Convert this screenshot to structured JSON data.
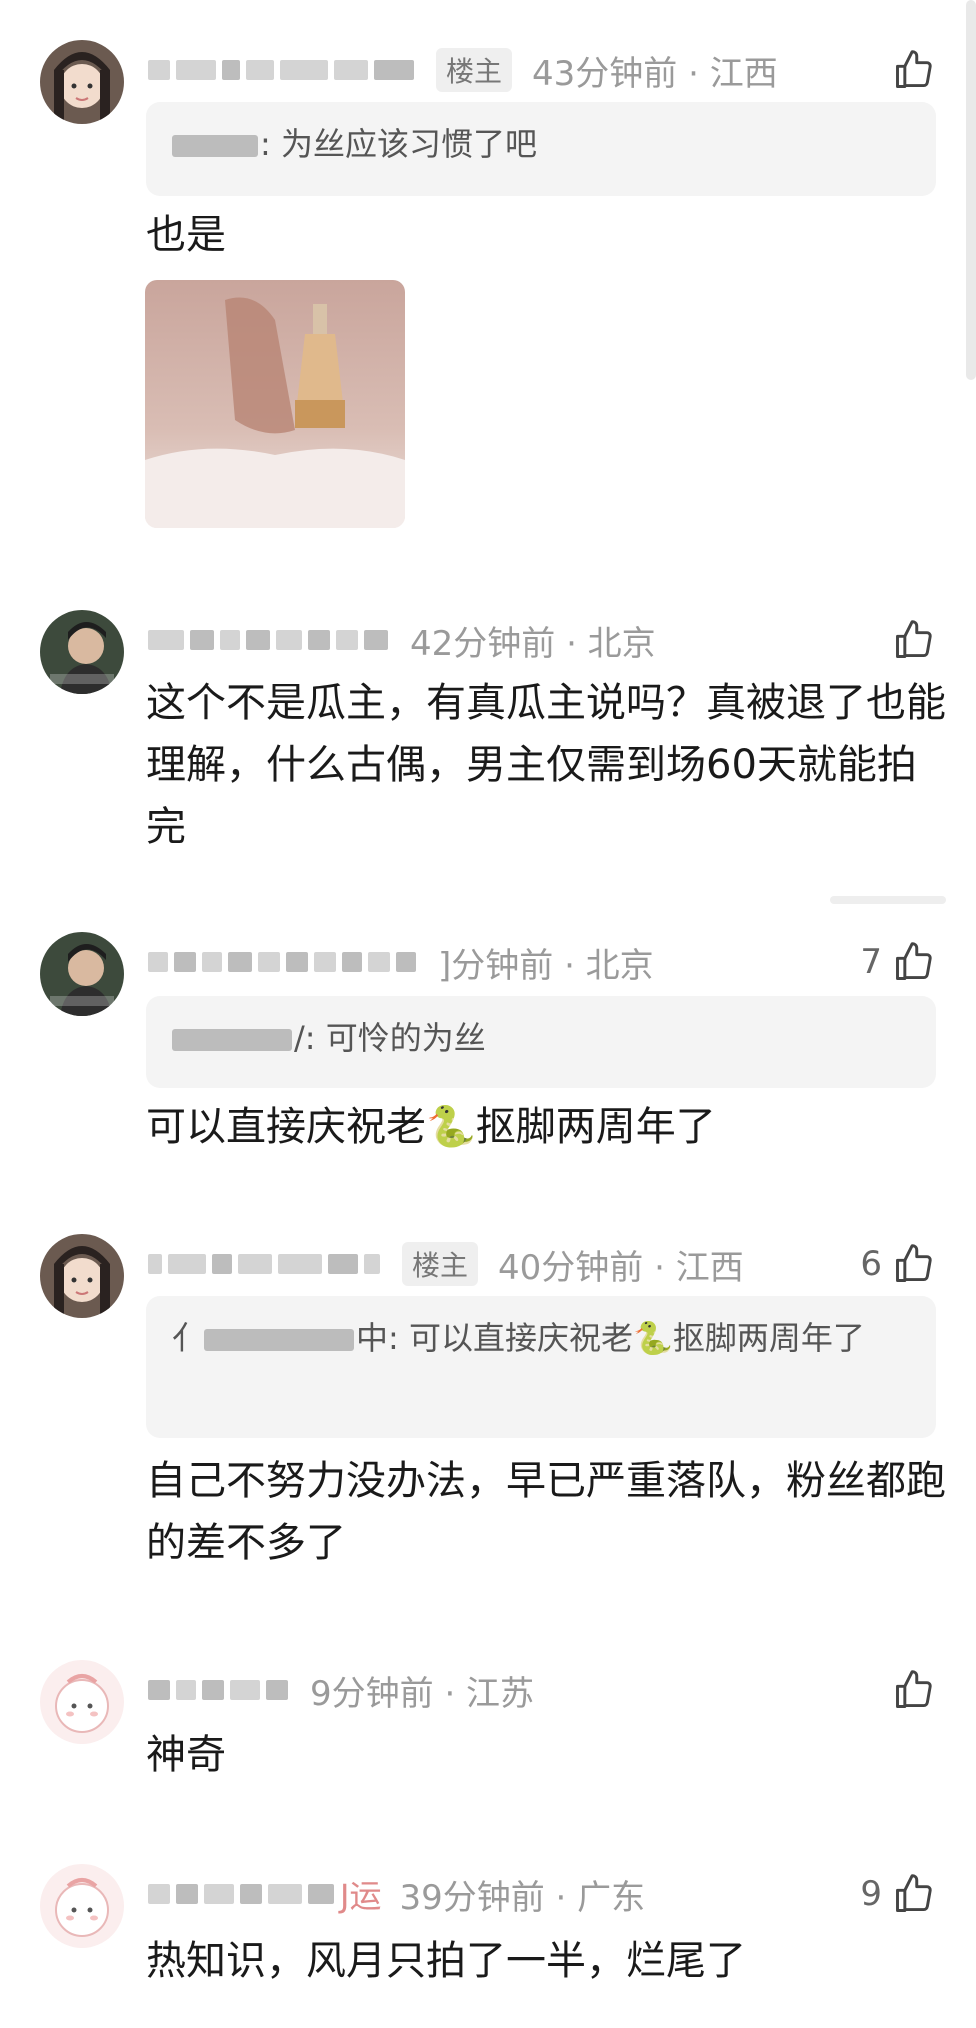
{
  "comments": [
    {
      "badge": "楼主",
      "meta": "43分钟前 · 江西",
      "likes": "",
      "quote_text": ": 为丝应该习惯了吧",
      "text": "也是"
    },
    {
      "badge": "",
      "meta": "42分钟前 · 北京",
      "likes": "",
      "text": "这个不是瓜主，有真瓜主说吗？真被退了也能理解，什么古偶，男主仅需到场60天就能拍完"
    },
    {
      "badge": "",
      "meta": "]分钟前 · 北京",
      "likes": "7",
      "quote_text": "/: 可怜的为丝",
      "text": "可以直接庆祝老🐍抠脚两周年了"
    },
    {
      "badge": "楼主",
      "meta": "40分钟前 · 江西",
      "likes": "6",
      "quote_prefix": "亻",
      "quote_text": "中: 可以直接庆祝老🐍抠脚两周年了",
      "text": "自己不努力没办法，早已严重落队，粉丝都跑的差不多了"
    },
    {
      "badge": "",
      "meta": "9分钟前 · 江苏",
      "likes": "",
      "text": "神奇"
    },
    {
      "badge": "",
      "tag": "J运",
      "meta": "39分钟前 · 广东",
      "likes": "9",
      "text": "热知识，风月只拍了一半，烂尾了"
    }
  ],
  "colors": {
    "meta": "#9a9a9a",
    "quote_bg": "#f4f4f4",
    "badge_bg": "#efefef",
    "tag_red": "#e08a8a"
  },
  "icons": {
    "like": "thumbs-up-icon"
  }
}
